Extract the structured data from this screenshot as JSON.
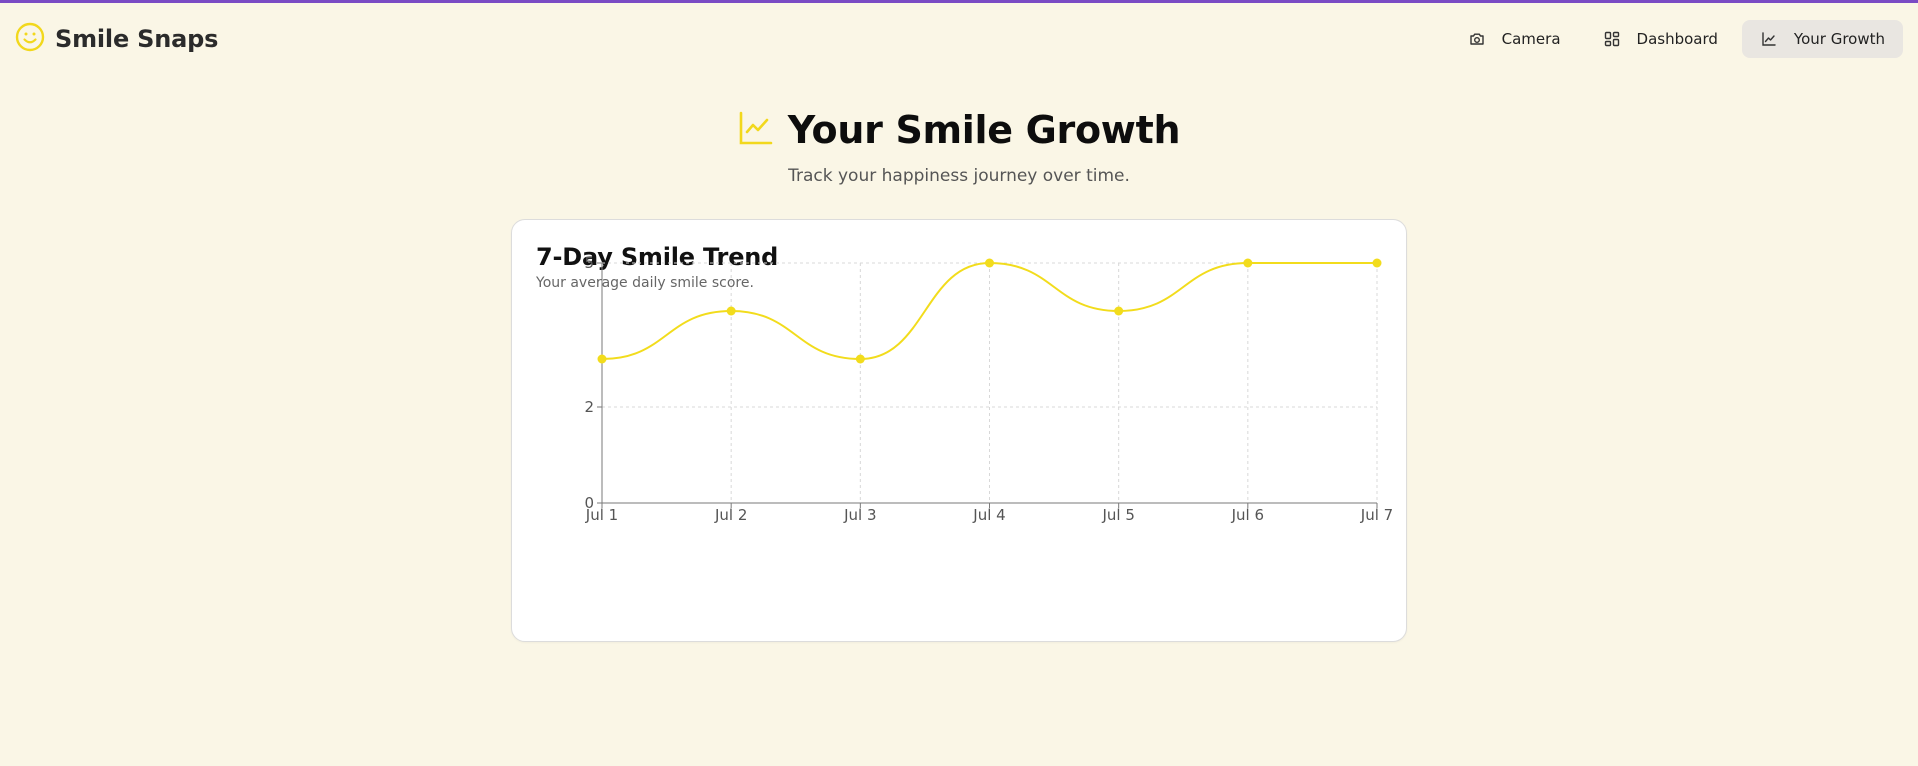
{
  "app": {
    "brand_name": "Smile Snaps",
    "accent_color": "#7a4bc4",
    "brand_color": "#f2d81c"
  },
  "nav": {
    "items": [
      {
        "label": "Camera",
        "icon": "camera-icon",
        "active": false
      },
      {
        "label": "Dashboard",
        "icon": "dashboard-grid-icon",
        "active": false
      },
      {
        "label": "Your Growth",
        "icon": "line-chart-icon",
        "active": true
      }
    ]
  },
  "hero": {
    "title": "Your Smile Growth",
    "subtitle": "Track your happiness journey over time.",
    "icon": "line-chart-icon"
  },
  "card": {
    "title": "7-Day Smile Trend",
    "subtitle": "Your average daily smile score."
  },
  "chart_data": {
    "type": "line",
    "categories": [
      "Jul 1",
      "Jul 2",
      "Jul 3",
      "Jul 4",
      "Jul 5",
      "Jul 6",
      "Jul 7"
    ],
    "series": [
      {
        "values": [
          3,
          4,
          3,
          5,
          4,
          5,
          5
        ],
        "color": "#f2dc1c"
      }
    ],
    "yticks": [
      "0",
      "2",
      "5"
    ],
    "ylim": [
      0,
      5
    ],
    "grid": true,
    "curve": "smooth",
    "xlabel": "",
    "ylabel": ""
  }
}
